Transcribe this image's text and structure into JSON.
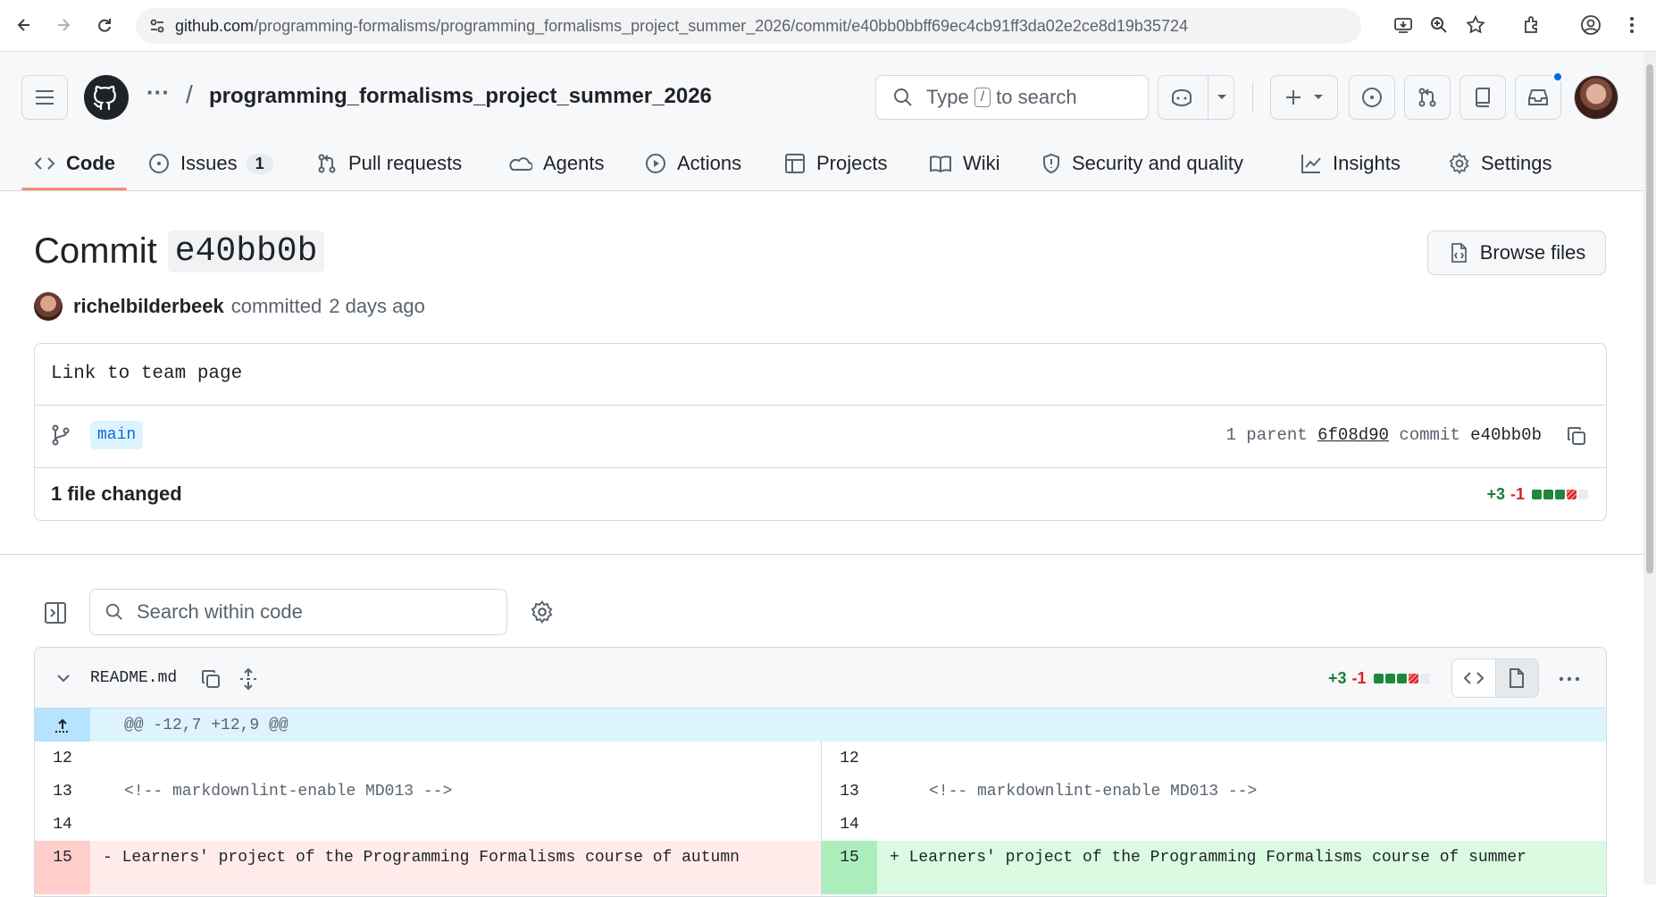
{
  "browser": {
    "url_host": "github.com",
    "url_path": "/programming-formalisms/programming_formalisms_project_summer_2026/commit/e40bb0bbff69ec4cb91ff3da02e2ce8d19b35724"
  },
  "header": {
    "ellipsis": "···",
    "separator": "/",
    "repo_name": "programming_formalisms_project_summer_2026",
    "search_prefix": "Type",
    "search_key": "/",
    "search_suffix": "to search"
  },
  "tabs": [
    {
      "label": "Code",
      "icon": "code-icon",
      "selected": true
    },
    {
      "label": "Issues",
      "icon": "issue-icon",
      "count": "1"
    },
    {
      "label": "Pull requests",
      "icon": "pull-request-icon"
    },
    {
      "label": "Agents",
      "icon": "agent-icon"
    },
    {
      "label": "Actions",
      "icon": "play-icon"
    },
    {
      "label": "Projects",
      "icon": "table-icon"
    },
    {
      "label": "Wiki",
      "icon": "book-icon"
    },
    {
      "label": "Security and quality",
      "icon": "shield-icon"
    },
    {
      "label": "Insights",
      "icon": "graph-icon"
    },
    {
      "label": "Settings",
      "icon": "gear-icon"
    }
  ],
  "commit": {
    "title_word": "Commit",
    "short_sha": "e40bb0b",
    "browse_files": "Browse files",
    "author": "richelbilderbeek",
    "action": "committed",
    "time": "2 days ago",
    "message": "Link to team page",
    "branch": "main",
    "parent_prefix": "1 parent",
    "parent_sha": "6f08d90",
    "commit_word": "commit",
    "commit_sha": "e40bb0b",
    "files_changed": "1 file changed",
    "additions": "+3",
    "deletions": "-1"
  },
  "code_search": {
    "placeholder": "Search within code"
  },
  "diff": {
    "file_name": "README.md",
    "additions": "+3",
    "deletions": "-1",
    "hunk_header": "@@ -12,7 +12,9 @@",
    "rows": [
      {
        "left_num": "12",
        "left_text": "",
        "right_num": "12",
        "right_text": "",
        "kind": "context"
      },
      {
        "left_num": "13",
        "left_text": "<!-- markdownlint-enable MD013 -->",
        "right_num": "13",
        "right_text": "<!-- markdownlint-enable MD013 -->",
        "kind": "context"
      },
      {
        "left_num": "14",
        "left_text": "",
        "right_num": "14",
        "right_text": "",
        "kind": "context"
      },
      {
        "left_num": "15",
        "left_text": "- Learners' project of the Programming Formalisms course of autumn",
        "right_num": "15",
        "right_text": "+ Learners' project of the Programming Formalisms course of summer",
        "kind": "change"
      }
    ]
  },
  "colors": {
    "accent_underline": "#fd8c73",
    "add_green": "#1a7f37",
    "del_red": "#d1242f",
    "hunk_bg": "#ddf4ff",
    "del_bg": "#ffebe9",
    "add_bg": "#dafbe1"
  }
}
